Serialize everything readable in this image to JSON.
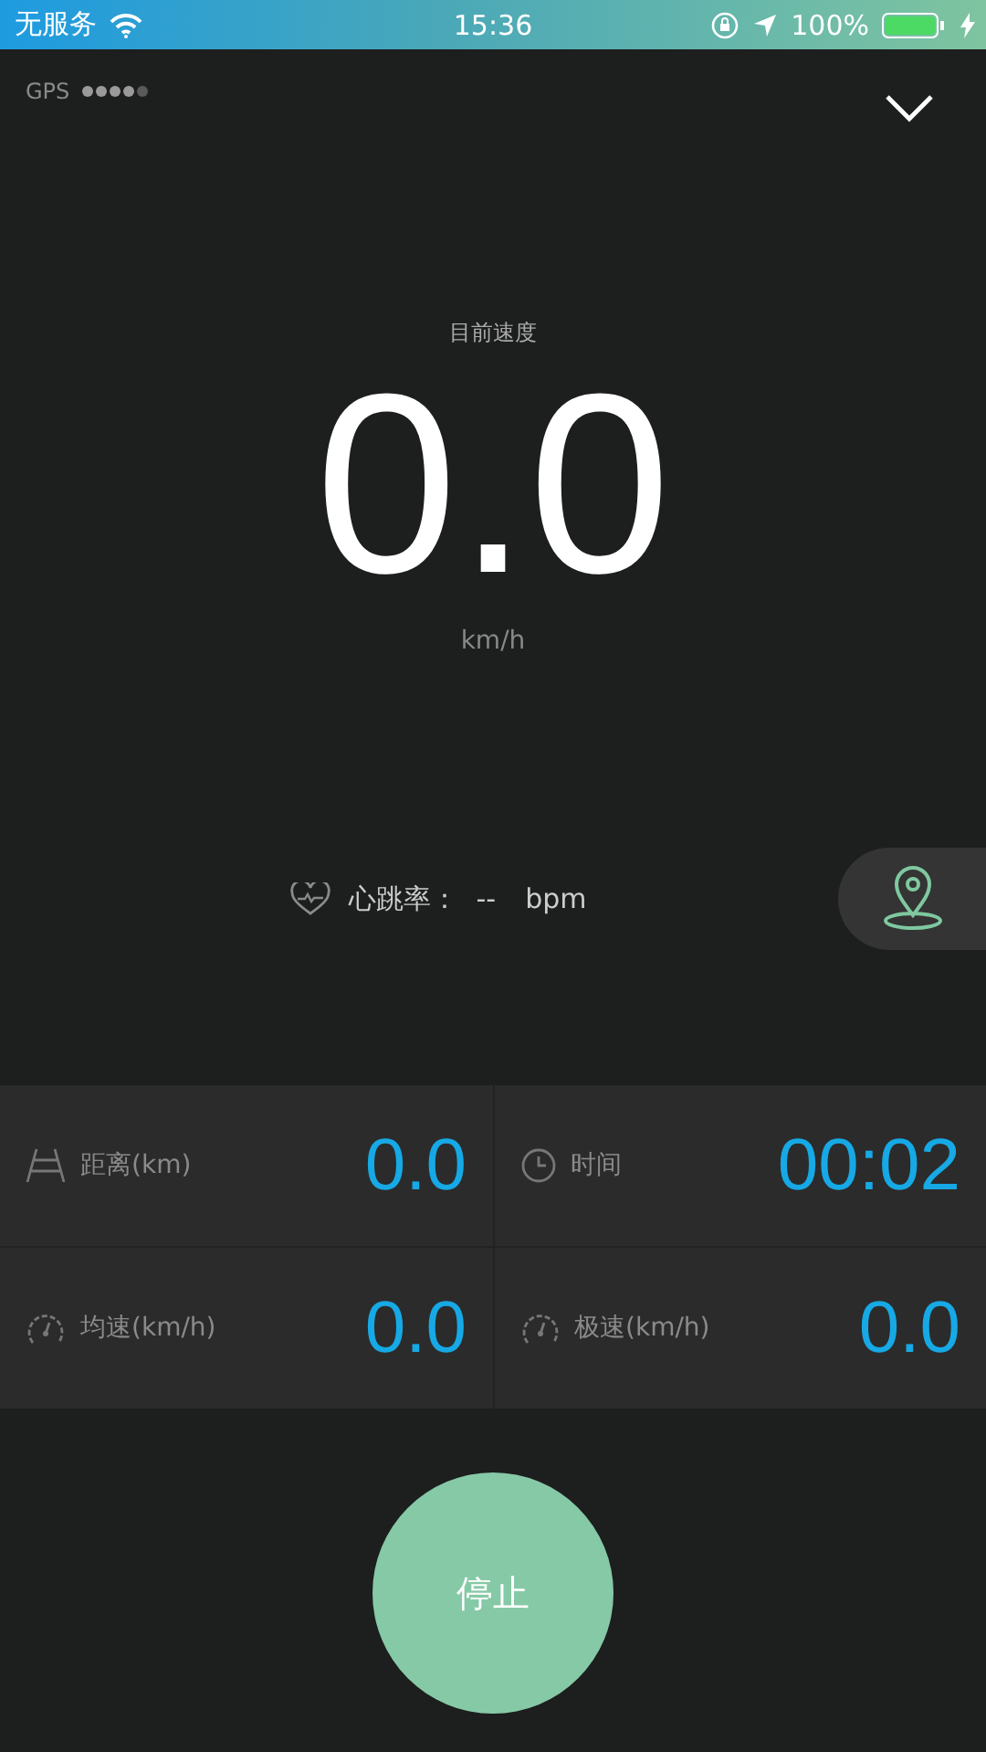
{
  "status_bar": {
    "carrier": "无服务",
    "time": "15:36",
    "battery": "100%"
  },
  "gps": {
    "label": "GPS"
  },
  "speed": {
    "label": "目前速度",
    "value": "0.0",
    "unit": "km/h"
  },
  "heart_rate": {
    "label": "心跳率：",
    "value": "--",
    "unit": "bpm"
  },
  "stats": [
    {
      "kind": "distance",
      "label": "距离(km)",
      "value": "0.0"
    },
    {
      "kind": "time",
      "label": "时间",
      "value": "00:02"
    },
    {
      "kind": "speed",
      "label": "均速(km/h)",
      "value": "0.0"
    },
    {
      "kind": "speed",
      "label": "极速(km/h)",
      "value": "0.0"
    }
  ],
  "stop_button": {
    "label": "停止"
  }
}
